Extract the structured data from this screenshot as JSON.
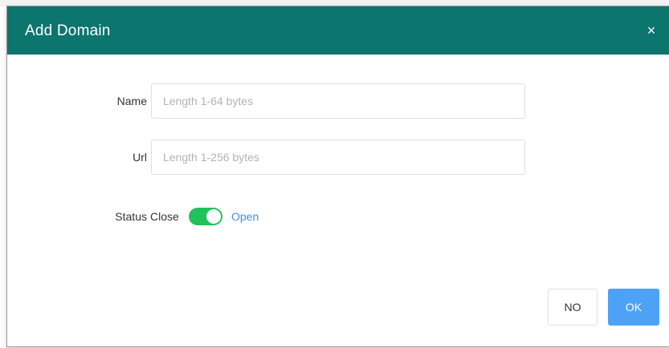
{
  "dialog": {
    "title": "Add Domain",
    "close_icon": "×",
    "header_color": "#0b756e"
  },
  "form": {
    "name": {
      "label": "Name",
      "value": "",
      "placeholder": "Length 1-64 bytes"
    },
    "url": {
      "label": "Url",
      "value": "",
      "placeholder": "Length 1-256 bytes"
    },
    "status": {
      "label": "Status",
      "off_label": "Close",
      "on_label": "Open",
      "enabled": true,
      "toggle_color": "#21c15c"
    }
  },
  "footer": {
    "no_label": "NO",
    "ok_label": "OK",
    "ok_color": "#4da2f5"
  }
}
